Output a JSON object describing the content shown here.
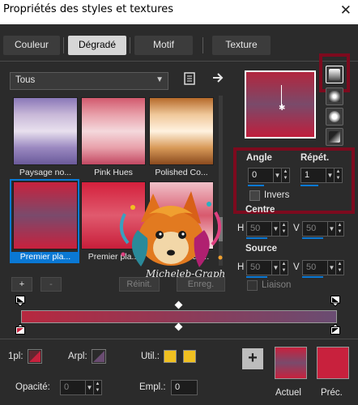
{
  "window": {
    "title": "Propriétés des styles et textures",
    "close_glyph": "✕"
  },
  "tabs": [
    {
      "label": "Couleur",
      "active": false
    },
    {
      "label": "Dégradé",
      "active": true
    },
    {
      "label": "Motif",
      "active": false
    },
    {
      "label": "Texture",
      "active": false
    }
  ],
  "library": {
    "category": "Tous",
    "icons": [
      "document-list-icon",
      "arrow-right-icon"
    ],
    "gradients": [
      {
        "label": "Paysage no...",
        "colors": [
          "#8a78b8",
          "#c8b8d8",
          "#e8e0ee",
          "#9a88c0",
          "#6a5a9a"
        ]
      },
      {
        "label": "Pink Hues",
        "colors": [
          "#d25a6e",
          "#e8a0aa",
          "#f4d8dc",
          "#e8a0aa",
          "#c24862"
        ]
      },
      {
        "label": "Polished Co...",
        "colors": [
          "#b66a2a",
          "#f0c89a",
          "#fff2e0",
          "#d89a58",
          "#8a4a1e"
        ]
      },
      {
        "label": "Premier pla...",
        "colors": [
          "#c8213d",
          "#7a4a6c",
          "#c8213d"
        ],
        "selected": true
      },
      {
        "label": "Premier pla...",
        "colors": [
          "#d4203c",
          "#e05a6e",
          "#c81e3a"
        ]
      },
      {
        "label": "Premier plan...",
        "colors": [
          "#f0c0c8",
          "#d85a6e",
          "#f8e0e4"
        ]
      }
    ]
  },
  "style_buttons": [
    "linear-gradient-icon",
    "rectangular-gradient-icon",
    "sunburst-gradient-icon",
    "radial-gradient-icon"
  ],
  "params": {
    "angle_label": "Angle",
    "angle_value": "0",
    "repeat_label": "Répét.",
    "repeat_value": "1",
    "invert_label": "Invers",
    "center_label": "Centre",
    "source_label": "Source",
    "h_label": "H",
    "v_label": "V",
    "center_h": "50",
    "center_v": "50",
    "source_h": "50",
    "source_v": "50",
    "link_label": "Liaison"
  },
  "gradient_editor": {
    "add": "+",
    "remove": "-",
    "reset": "Réinit.",
    "save": "Enreg.",
    "colors": [
      "#b7283f",
      "#8f3a57",
      "#6a4c72"
    ]
  },
  "bottom": {
    "fg_label": "1pl:",
    "bg_label": "Arpl:",
    "util_label": "Util.:",
    "opacity_label": "Opacité:",
    "opacity_value": "0",
    "empl_label": "Empl.:",
    "empl_value": "0",
    "current_label": "Actuel",
    "previous_label": "Préc.",
    "util_color": "#f0c020",
    "previous_color": "#c8213d"
  },
  "watermark": "Micheleb-Graph",
  "accent": "#0a78d4",
  "highlight": "#7d0a1e"
}
